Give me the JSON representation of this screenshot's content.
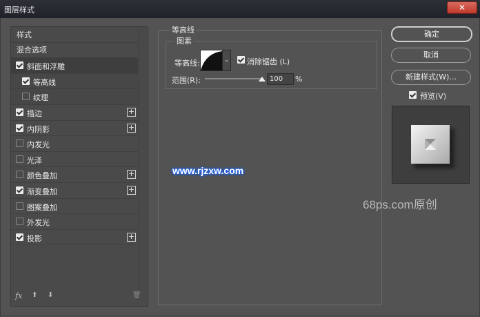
{
  "window": {
    "title": "图层样式",
    "close": "✕"
  },
  "styles_panel": {
    "items": [
      {
        "label": "样式",
        "kind": "header"
      },
      {
        "label": "混合选项",
        "kind": "header"
      },
      {
        "label": "斜面和浮雕",
        "checked": true,
        "kind": "main",
        "selected": "parent"
      },
      {
        "label": "等高线",
        "checked": true,
        "kind": "sub",
        "selected": "active"
      },
      {
        "label": "纹理",
        "checked": false,
        "kind": "sub"
      },
      {
        "label": "描边",
        "checked": true,
        "kind": "main",
        "plus": true
      },
      {
        "label": "内阴影",
        "checked": true,
        "kind": "main",
        "plus": true
      },
      {
        "label": "内发光",
        "checked": false,
        "kind": "main"
      },
      {
        "label": "光泽",
        "checked": false,
        "kind": "main"
      },
      {
        "label": "颜色叠加",
        "checked": false,
        "kind": "main",
        "plus": true
      },
      {
        "label": "渐变叠加",
        "checked": true,
        "kind": "main",
        "plus": true
      },
      {
        "label": "图案叠加",
        "checked": false,
        "kind": "main"
      },
      {
        "label": "外发光",
        "checked": false,
        "kind": "main"
      },
      {
        "label": "投影",
        "checked": true,
        "kind": "main",
        "plus": true
      }
    ],
    "bottom": {
      "fx": "fx",
      "up": "⬆",
      "down": "⬇",
      "trash": "🗑"
    }
  },
  "contour_section": {
    "title": "等高线",
    "group_title": "图素",
    "contour_label": "等高线:",
    "contour_dropdown_icon": "⌄",
    "anti_alias_label": "消除锯齿 (L)",
    "anti_alias_checked": true,
    "range_label": "范围(R):",
    "range_value": "100",
    "range_unit": "%"
  },
  "buttons": {
    "ok": "确定",
    "cancel": "取消",
    "new_style": "新建样式(W)...",
    "preview_label": "预览(V)",
    "preview_checked": true
  },
  "watermarks": {
    "site1": "www.rjzxw.com",
    "site2": "68ps.com原创"
  },
  "colors": {
    "background": "#535353",
    "titlebar": "#23252c",
    "close": "#c9483a",
    "watermark_glow": "#1a64ff"
  }
}
